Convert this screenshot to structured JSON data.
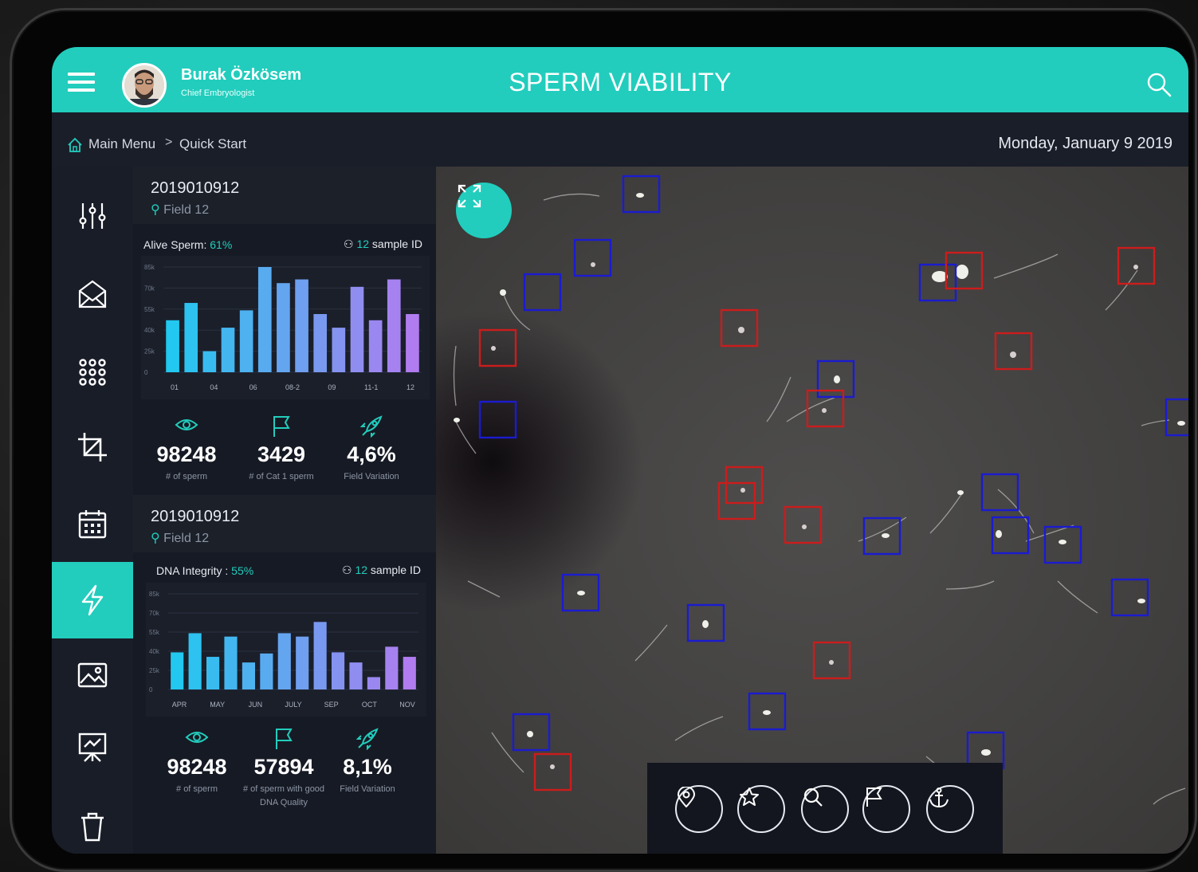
{
  "header": {
    "title": "SPERM VIABILITY",
    "user_name": "Burak Özkösem",
    "user_role": "Chief Embryologist",
    "menu_icon": "hamburger-icon",
    "search_icon": "search-icon"
  },
  "breadcrumb": {
    "home": "Main Menu",
    "separator": ">",
    "current": "Quick Start",
    "date": "Monday, January 9 2019"
  },
  "nav": {
    "items": [
      {
        "icon": "sliders-icon"
      },
      {
        "icon": "mail-open-icon"
      },
      {
        "icon": "grid-icon"
      },
      {
        "icon": "crop-icon"
      },
      {
        "icon": "calendar-icon"
      },
      {
        "icon": "lightning-icon",
        "active": true
      },
      {
        "icon": "image-icon"
      },
      {
        "icon": "presentation-icon"
      },
      {
        "icon": "trash-icon"
      }
    ]
  },
  "cards": [
    {
      "sample_code": "2019010912",
      "field": "Field 12",
      "metric_label": "Alive Sperm:",
      "metric_value": "61%",
      "sample_count": "12",
      "sample_label": "sample ID",
      "stats": [
        {
          "icon": "eye-icon",
          "value": "98248",
          "label": "# of sperm"
        },
        {
          "icon": "flag-icon",
          "value": "3429",
          "label": "# of Cat 1 sperm"
        },
        {
          "icon": "rocket-icon",
          "value": "4,6%",
          "label": "Field Variation"
        }
      ]
    },
    {
      "sample_code": "2019010912",
      "field": "Field 12",
      "metric_label": "DNA Integrity :",
      "metric_value": "55%",
      "sample_count": "12",
      "sample_label": "sample ID",
      "stats": [
        {
          "icon": "eye-icon",
          "value": "98248",
          "label": "# of sperm"
        },
        {
          "icon": "flag-icon",
          "value": "57894",
          "label": "# of sperm with good DNA Quality"
        },
        {
          "icon": "rocket-icon",
          "value": "8,1%",
          "label": "Field Variation"
        }
      ]
    }
  ],
  "chart_data": [
    {
      "type": "bar",
      "y_ticks": [
        "85k",
        "70k",
        "55k",
        "40k",
        "25k",
        "0"
      ],
      "x_ticks": [
        "01",
        "04",
        "06",
        "08-2",
        "09",
        "11-1",
        "12"
      ],
      "ylim": [
        0,
        85000
      ],
      "values": [
        42000,
        56000,
        17000,
        36000,
        50000,
        85000,
        72000,
        75000,
        47000,
        36000,
        69000,
        42000,
        75000,
        47000
      ]
    },
    {
      "type": "bar",
      "y_ticks": [
        "85k",
        "70k",
        "55k",
        "40k",
        "25k",
        "0"
      ],
      "x_ticks": [
        "APR",
        "MAY",
        "JUN",
        "JULY",
        "SEP",
        "OCT",
        "NOV"
      ],
      "ylim": [
        0,
        85000
      ],
      "values": [
        33000,
        50000,
        29000,
        47000,
        24000,
        32000,
        50000,
        47000,
        60000,
        33000,
        24000,
        11000,
        38000,
        29000
      ]
    }
  ],
  "micrograph": {
    "expand_icon": "expand-icon",
    "toolbar": [
      {
        "icon": "location-pin-icon"
      },
      {
        "icon": "star-icon"
      },
      {
        "icon": "zoom-icon"
      },
      {
        "icon": "flag-icon"
      },
      {
        "icon": "anchor-icon"
      }
    ],
    "box_colors": {
      "alive": "#1b1bd0",
      "dead": "#cc1c1c"
    }
  },
  "colors": {
    "accent": "#22cdbd",
    "bar_start": "#22c8f0",
    "bar_end": "#b07cf0"
  }
}
